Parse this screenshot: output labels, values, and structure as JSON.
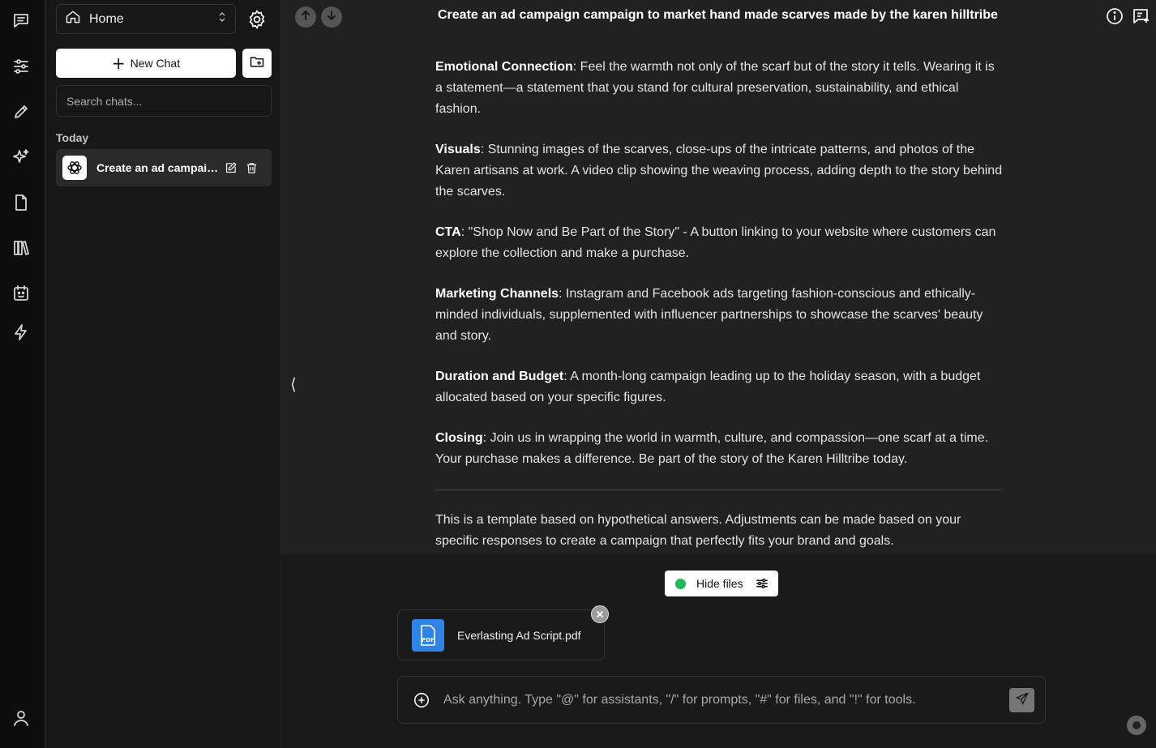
{
  "rail": {
    "items": [
      {
        "icon": "chat-icon"
      },
      {
        "icon": "sliders-icon"
      },
      {
        "icon": "pencil-icon"
      },
      {
        "icon": "sparkles-icon"
      },
      {
        "icon": "file-icon"
      },
      {
        "icon": "library-icon"
      },
      {
        "icon": "calendar-bot-icon"
      },
      {
        "icon": "lightning-icon"
      }
    ],
    "bottom_icon": "user-icon"
  },
  "sidebar": {
    "workspace_label": "Home",
    "new_chat_label": "New Chat",
    "search_placeholder": "Search chats...",
    "section_today": "Today",
    "chats": [
      {
        "title": "Create an ad campaign campaign to market hand made scarves made by the karen hilltribe"
      }
    ]
  },
  "header": {
    "title": "Create an ad campaign campaign to market hand made scarves made by the karen hilltribe"
  },
  "messages": {
    "sections": [
      {
        "heading": "Emotional Connection",
        "body": ": Feel the warmth not only of the scarf but of the story it tells. Wearing it is a statement—a statement that you stand for cultural preservation, sustainability, and ethical fashion."
      },
      {
        "heading": "Visuals",
        "body": ": Stunning images of the scarves, close-ups of the intricate patterns, and photos of the Karen artisans at work. A video clip showing the weaving process, adding depth to the story behind the scarves."
      },
      {
        "heading": "CTA",
        "body": ": \"Shop Now and Be Part of the Story\" - A button linking to your website where customers can explore the collection and make a purchase."
      },
      {
        "heading": "Marketing Channels",
        "body": ": Instagram and Facebook ads targeting fashion-conscious and ethically-minded individuals, supplemented with influencer partnerships to showcase the scarves' beauty and story."
      },
      {
        "heading": "Duration and Budget",
        "body": ": A month-long campaign leading up to the holiday season, with a budget allocated based on your specific figures."
      },
      {
        "heading": "Closing",
        "body": ": Join us in wrapping the world in warmth, culture, and compassion—one scarf at a time. Your purchase makes a difference. Be part of the story of the Karen Hilltribe today."
      }
    ],
    "footer_note": "This is a template based on hypothetical answers. Adjustments can be made based on your specific responses to create a campaign that perfectly fits your brand and goals."
  },
  "collapse_toggle": "⟨",
  "files": {
    "toggle_label": "Hide files",
    "status_color": "#1fb954",
    "attached": [
      {
        "name": "Everlasting Ad Script.pdf",
        "type_label": "PDF",
        "badge_color": "#2f84e6"
      }
    ]
  },
  "composer": {
    "placeholder": "Ask anything. Type \"@\" for assistants, \"/\" for prompts, \"#\" for files, and \"!\" for tools."
  }
}
